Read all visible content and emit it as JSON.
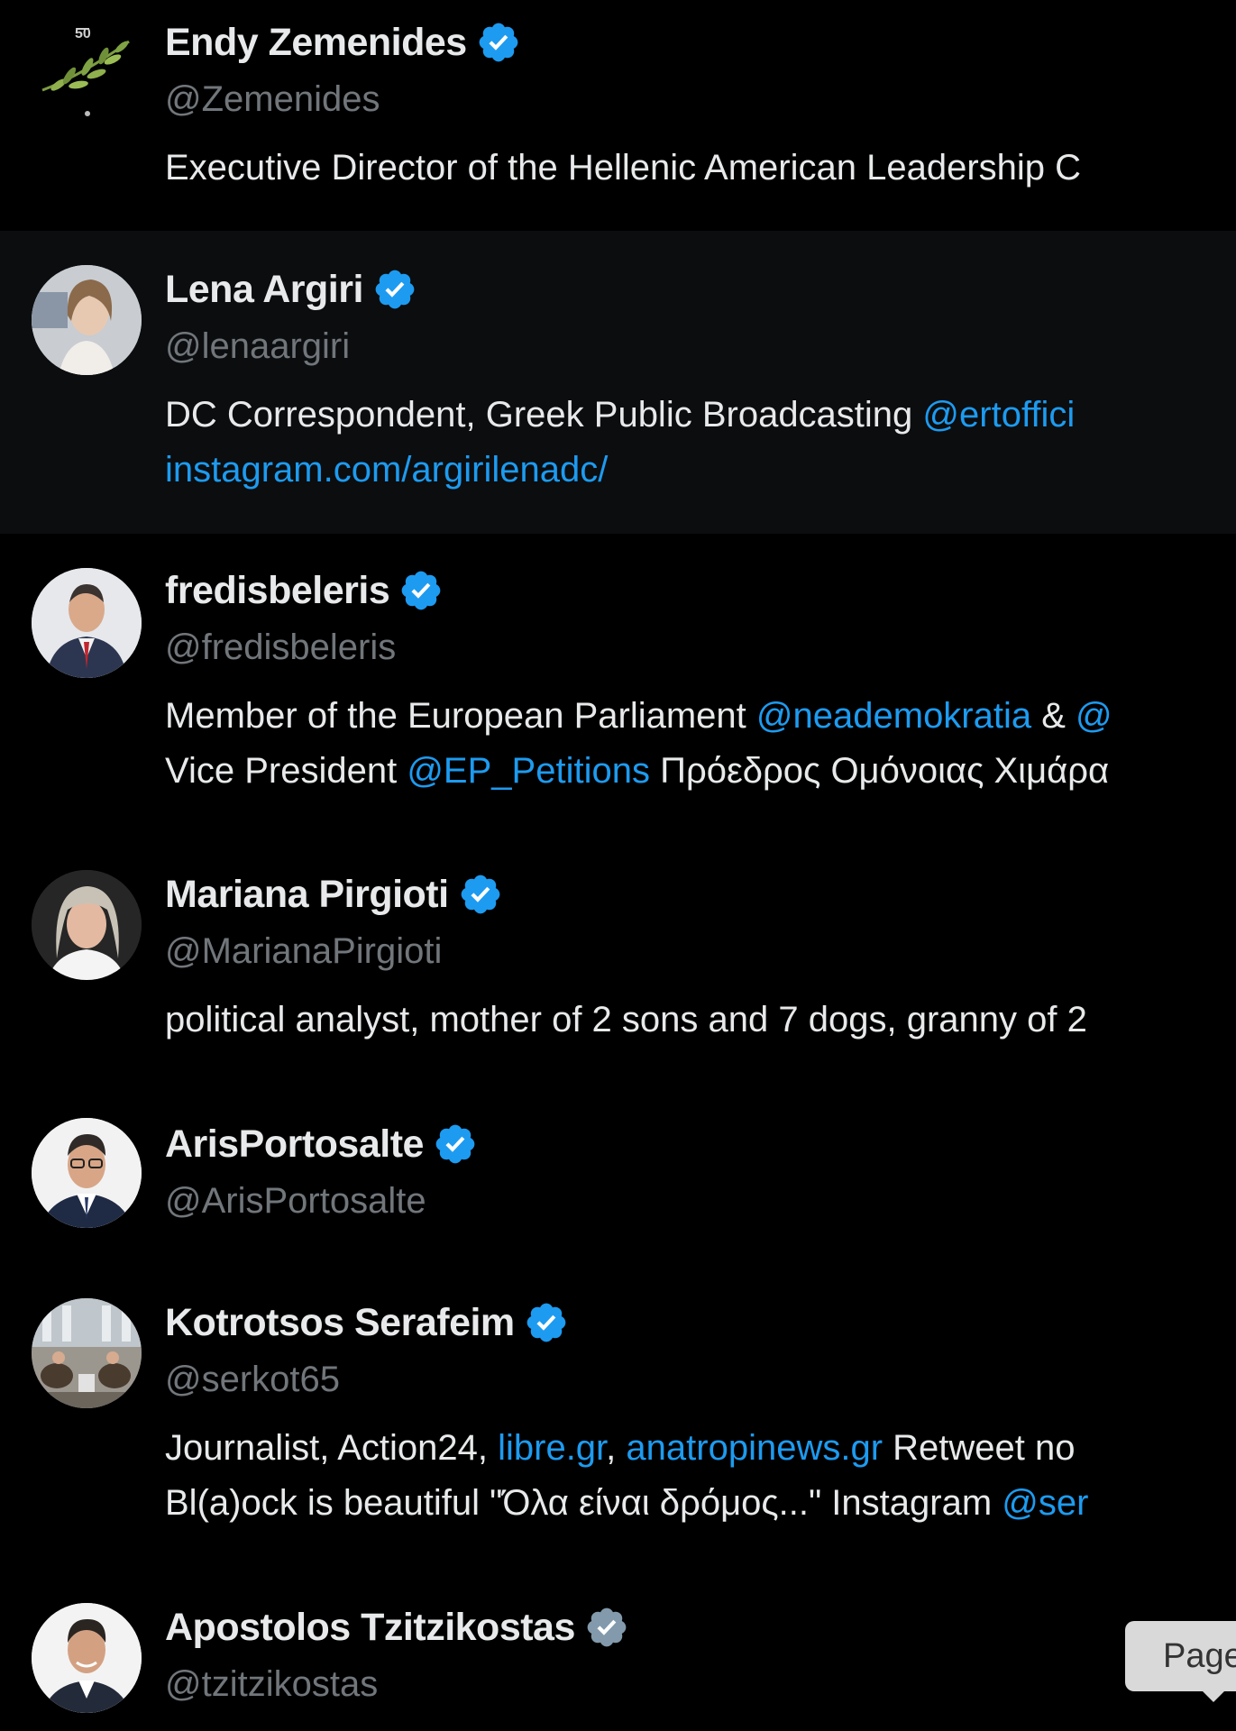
{
  "accounts": [
    {
      "name": "Endy Zemenides",
      "handle": "@Zemenides",
      "verified_color": "#1d9bf0",
      "avatar_icon": "olive-branch-logo",
      "bio_lines": [
        [
          {
            "text": "Executive Director of the Hellenic American Leadership C"
          }
        ]
      ]
    },
    {
      "name": "Lena Argiri",
      "handle": "@lenaargiri",
      "verified_color": "#1d9bf0",
      "avatar_icon": "portrait-photo",
      "bio_lines": [
        [
          {
            "text": "DC Correspondent, Greek Public Broadcasting "
          },
          {
            "text": "@ertoffici",
            "link": true
          }
        ],
        [
          {
            "text": "instagram.com/argirilenadc/",
            "link": true
          }
        ]
      ]
    },
    {
      "name": "fredisbeleris",
      "handle": "@fredisbeleris",
      "verified_color": "#1d9bf0",
      "avatar_icon": "portrait-photo",
      "bio_lines": [
        [
          {
            "text": "Member of the European Parliament "
          },
          {
            "text": "@neademokratia",
            "link": true
          },
          {
            "text": " & "
          },
          {
            "text": "@",
            "link": true
          }
        ],
        [
          {
            "text": "Vice President "
          },
          {
            "text": "@EP_Petitions",
            "link": true
          },
          {
            "text": " Πρόεδρος Ομόνοιας Χιμάρα"
          }
        ]
      ]
    },
    {
      "name": "Mariana Pirgioti",
      "handle": "@MarianaPirgioti",
      "verified_color": "#1d9bf0",
      "avatar_icon": "portrait-photo",
      "bio_lines": [
        [
          {
            "text": "political analyst, mother of 2 sons and 7 dogs, granny of 2"
          }
        ]
      ]
    },
    {
      "name": "ArisPortosalte",
      "handle": "@ArisPortosalte",
      "verified_color": "#1d9bf0",
      "avatar_icon": "portrait-photo",
      "bio_lines": []
    },
    {
      "name": "Kotrotsos Serafeim",
      "handle": "@serkot65",
      "verified_color": "#1d9bf0",
      "avatar_icon": "studio-photo",
      "bio_lines": [
        [
          {
            "text": "Journalist, Action24, "
          },
          {
            "text": "libre.gr",
            "link": true
          },
          {
            "text": ", "
          },
          {
            "text": "anatropinews.gr",
            "link": true
          },
          {
            "text": " Retweet no"
          }
        ],
        [
          {
            "text": "Bl(a)ock is beautiful \"Όλα είναι δρόμος...\" Instagram "
          },
          {
            "text": "@ser",
            "link": true
          }
        ]
      ]
    },
    {
      "name": "Apostolos Tzitzikostas",
      "handle": "@tzitzikostas",
      "verified_color": "#829aab",
      "avatar_icon": "portrait-photo",
      "bio_lines": []
    }
  ],
  "tooltip": {
    "text": "Page"
  }
}
